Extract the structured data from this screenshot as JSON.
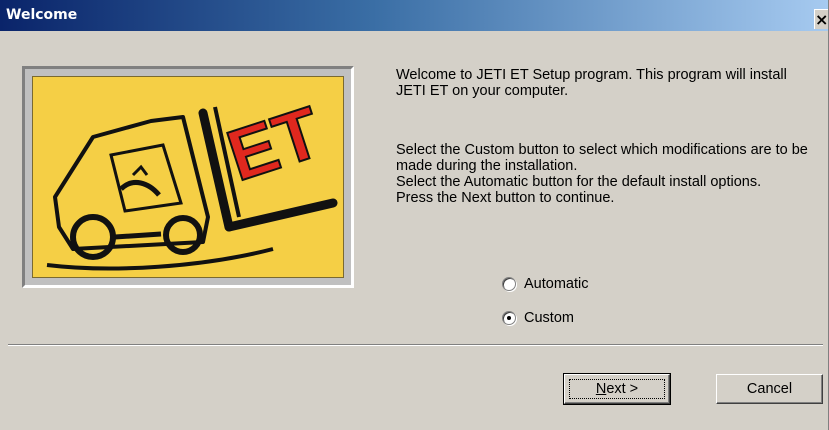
{
  "window": {
    "title": "Welcome",
    "close_glyph": "✕"
  },
  "logo": {
    "text": "ET",
    "colors": {
      "background": "#f5cf45",
      "ink": "#111111",
      "red": "#e0281e"
    }
  },
  "intro": {
    "paragraph1": "Welcome to JETI ET Setup program. This program will install JETI ET on your computer.",
    "paragraph2_line1": "Select the Custom button to select which modifications are to be made during the installation.",
    "paragraph2_line2": "Select the Automatic button for the default install options.",
    "paragraph2_line3": "Press the Next button to continue."
  },
  "options": {
    "automatic_label": "Automatic",
    "custom_label": "Custom",
    "selected": "Custom"
  },
  "buttons": {
    "next_mnemonic": "N",
    "next_rest": "ext >",
    "cancel_label": "Cancel"
  }
}
